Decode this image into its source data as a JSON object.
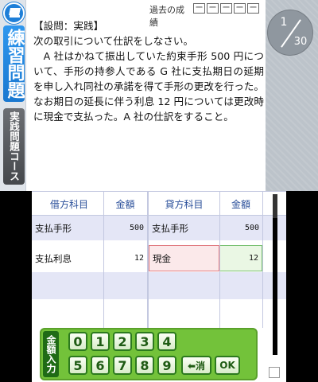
{
  "sidebar": {
    "mode_label": "練習問題",
    "course_label": "実践問題コース"
  },
  "history": {
    "label": "過去の成績",
    "marks": [
      "ー",
      "ー",
      "ー",
      "ー",
      "ー"
    ]
  },
  "question": {
    "tag": "【設問：実践】",
    "title": "次の取引について仕訳をしなさい。",
    "body": "A 社はかねて振出していた約束手形 500 円について、手形の持参人である G 社に支払期日の延期を申し入れ同社の承諾を得て手形の更改を行った。なお期日の延長に伴う利息 12 円については更改時に現金で支払った。A 社の仕訳をすること。"
  },
  "page": {
    "current": "1",
    "total": "30"
  },
  "journal": {
    "headers": [
      "借方科目",
      "金額",
      "貸方科目",
      "金額"
    ],
    "rows": [
      {
        "debit_account": "支払手形",
        "debit_amount": "500",
        "credit_account": "支払手形",
        "credit_amount": "500"
      },
      {
        "debit_account": "支払利息",
        "debit_amount": "12",
        "credit_account": "現金",
        "credit_amount": "12"
      }
    ]
  },
  "keypad": {
    "label": "金額入力",
    "row1": [
      "0",
      "1",
      "2",
      "3",
      "4"
    ],
    "row2": [
      "5",
      "6",
      "7",
      "8",
      "9"
    ],
    "delete_label": "⬅消",
    "ok_label": "OK"
  },
  "colors": {
    "accent_blue": "#1e7fd8",
    "keypad_green": "#73c23a",
    "row_stripe": "#e4e6f6",
    "error_cell": "#e07a80",
    "correct_cell": "#78c070"
  }
}
